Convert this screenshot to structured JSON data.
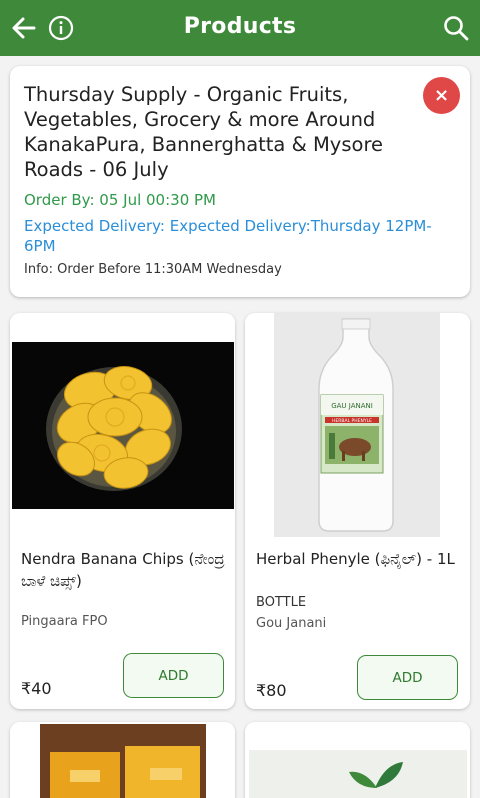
{
  "header": {
    "title": "Products",
    "back_icon": "arrow-left-icon",
    "info_icon": "info-icon",
    "search_icon": "search-icon"
  },
  "supply": {
    "title": "Thursday Supply - Organic Fruits, Vegetables, Grocery & more Around KanakaPura, Bannerghatta & Mysore Roads - 06 July",
    "order_by": "Order By: 05 Jul 00:30 PM",
    "expected": "Expected Delivery: Expected Delivery:Thursday 12PM-6PM",
    "info": "Info: Order Before 11:30AM Wednesday",
    "close_label": "×"
  },
  "products": [
    {
      "name": "Nendra Banana Chips (ನೇಂದ್ರ ಬಾಳೆ ಚಿಪ್ಸ್)",
      "unit": "",
      "seller": "Pingaara FPO",
      "price": "₹40",
      "add_label": "ADD"
    },
    {
      "name": "Herbal Phenyle (ಫಿನೈಲ್) - 1L",
      "unit": "BOTTLE",
      "seller": "Gou Janani",
      "price": "₹80",
      "add_label": "ADD",
      "bottle_label": "GAU JANANI",
      "bottle_sublabel": "HERBAL PHENYLE"
    }
  ],
  "colors": {
    "header": "#3f8a3a",
    "order_by": "#2f9a4a",
    "expected": "#2a8ed8",
    "close": "#e04848"
  }
}
